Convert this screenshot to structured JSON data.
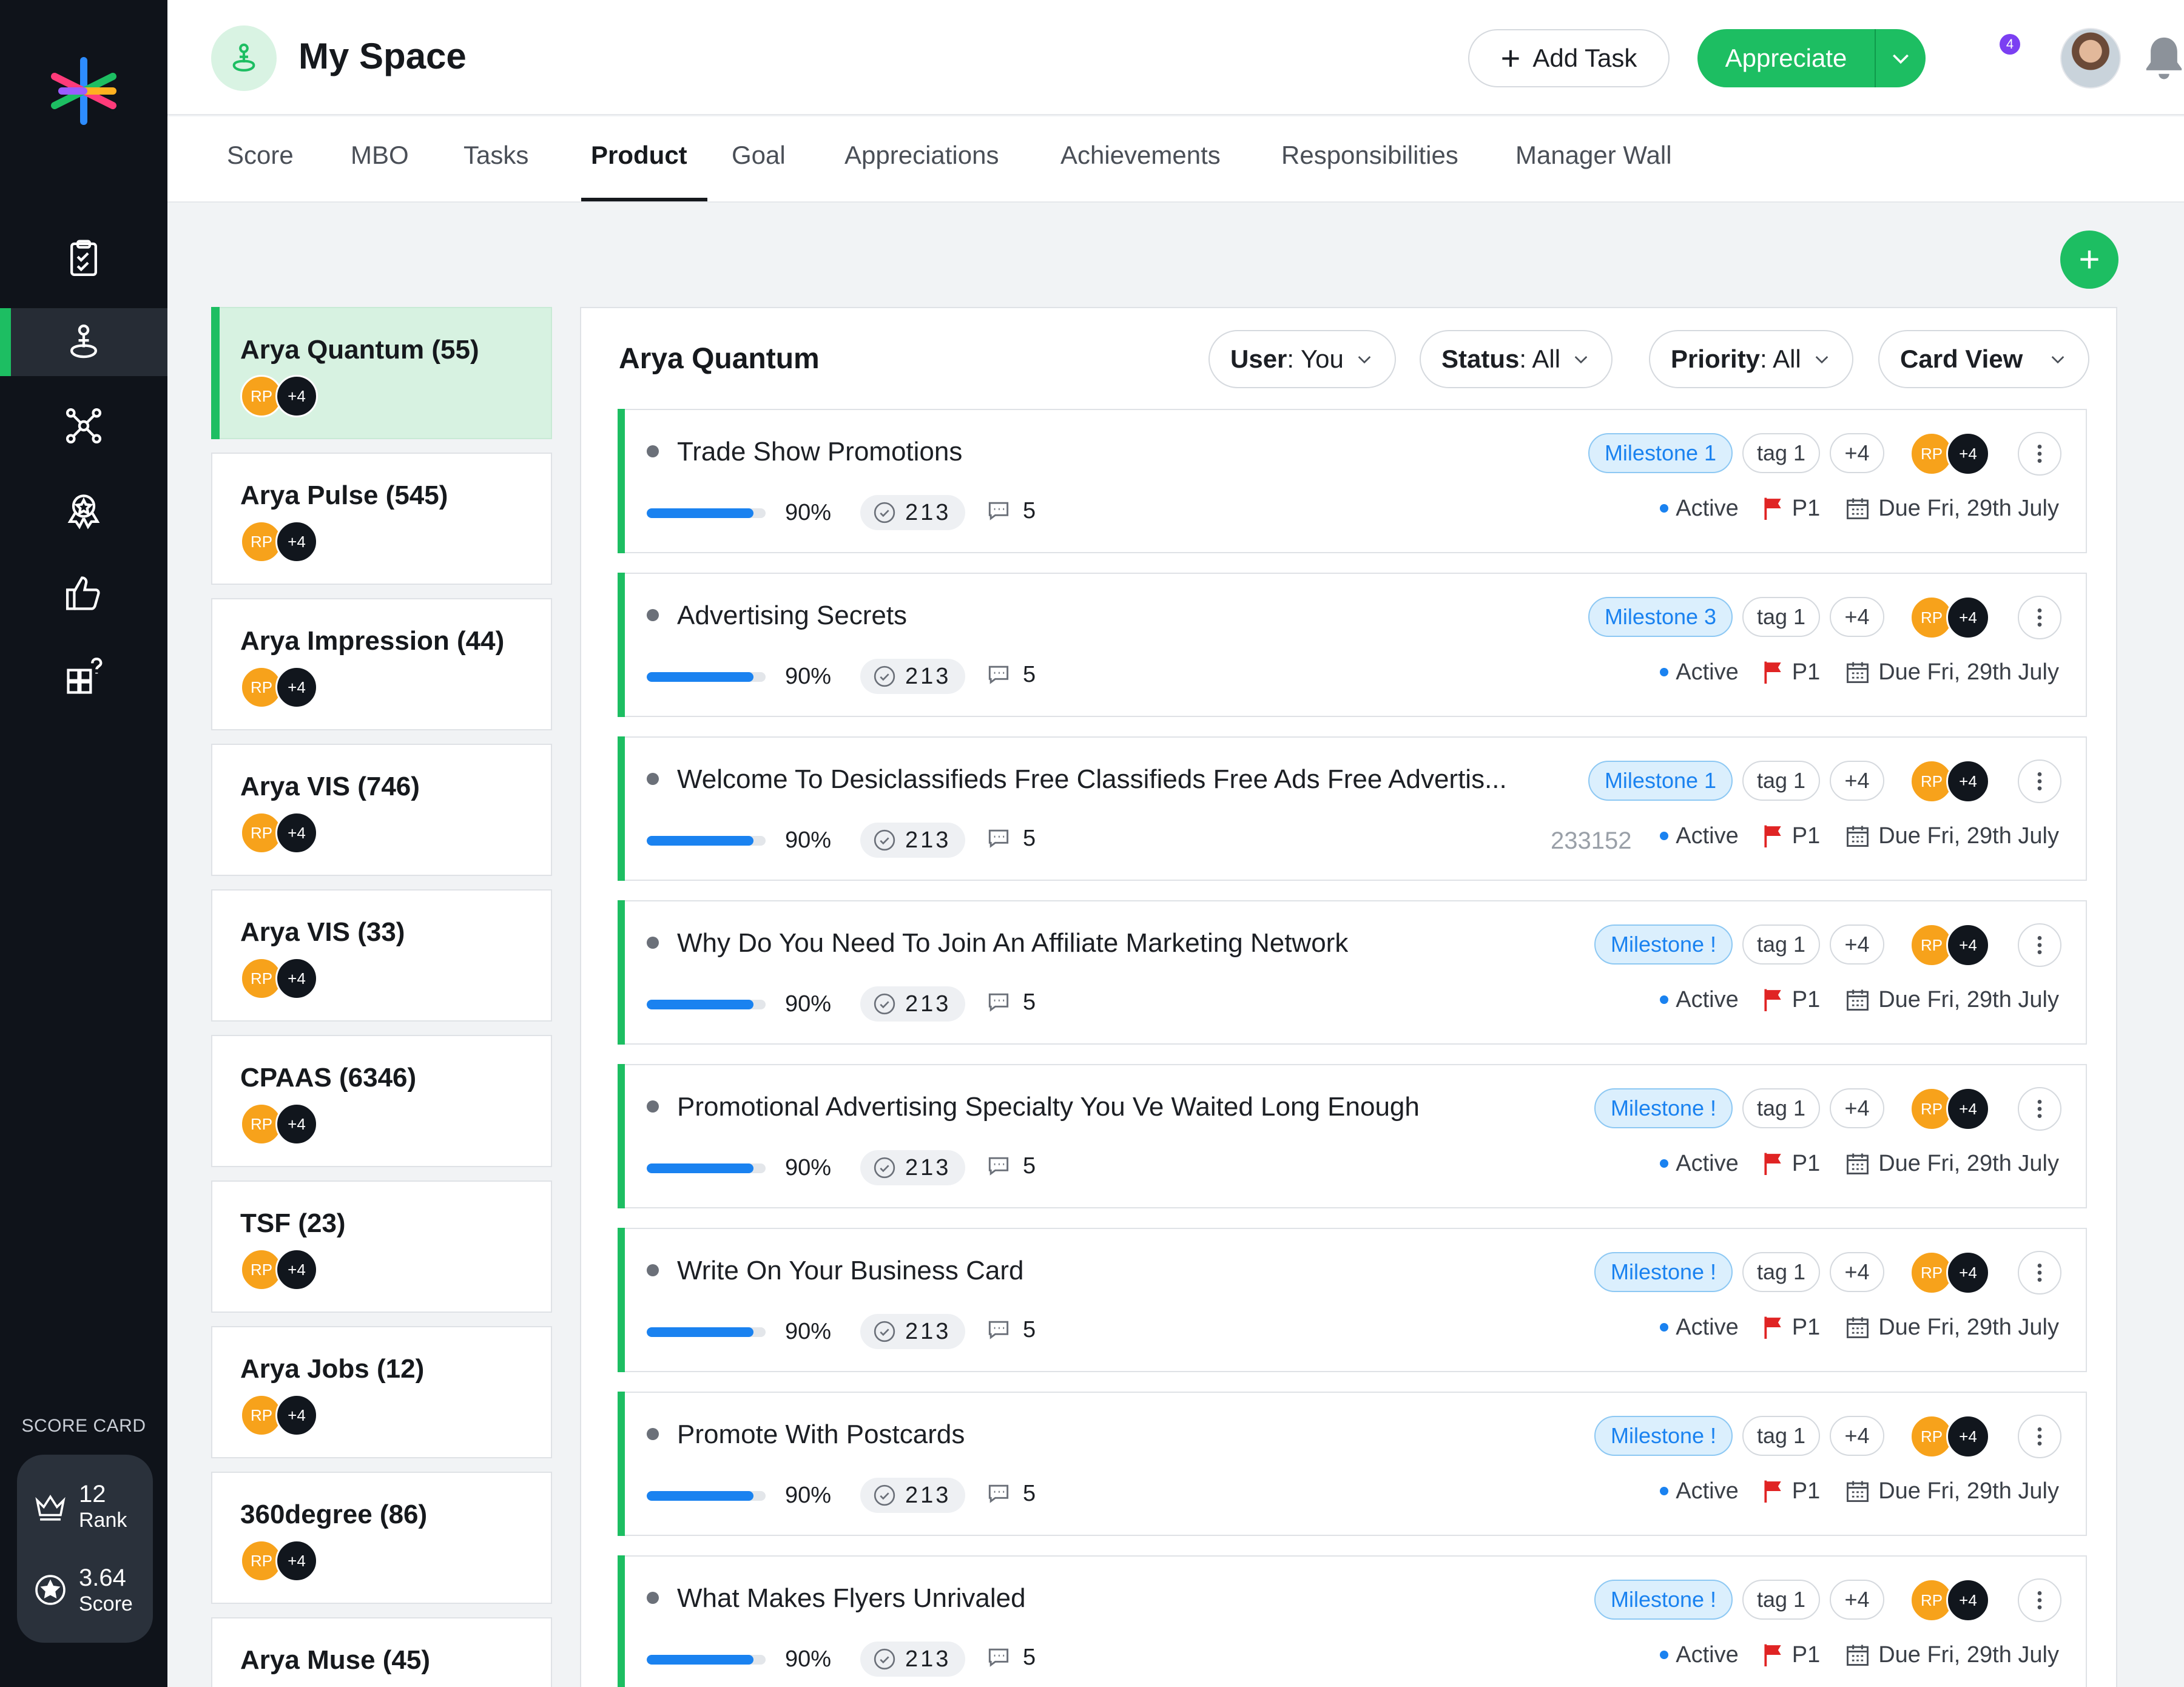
{
  "header": {
    "title": "My Space",
    "add_task_label": "Add Task",
    "appreciate_label": "Appreciate",
    "notification_count": "4"
  },
  "tabs": [
    {
      "label": "Score"
    },
    {
      "label": "MBO"
    },
    {
      "label": "Tasks"
    },
    {
      "label": "Product",
      "active": true
    },
    {
      "label": "Goal"
    },
    {
      "label": "Appreciations"
    },
    {
      "label": "Achievements"
    },
    {
      "label": "Responsibilities"
    },
    {
      "label": "Manager Wall"
    }
  ],
  "scorecard": {
    "caption": "SCORE CARD",
    "rank_value": "12",
    "rank_label": "Rank",
    "score_value": "3.64",
    "score_label": "Score"
  },
  "products": [
    {
      "name": "Arya Quantum (55)",
      "active": true
    },
    {
      "name": "Arya Pulse (545)"
    },
    {
      "name": "Arya Impression (44)"
    },
    {
      "name": "Arya VIS (746)"
    },
    {
      "name": "Arya VIS (33)"
    },
    {
      "name": "CPAAS (6346)"
    },
    {
      "name": "TSF (23)"
    },
    {
      "name": "Arya Jobs (12)"
    },
    {
      "name": "360degree (86)"
    },
    {
      "name": "Arya Muse (45)"
    }
  ],
  "avatar_initials": "RP",
  "avatar_more": "+4",
  "panel": {
    "title": "Arya Quantum",
    "filters": {
      "user_key": "User",
      "user_value": ": You",
      "status_key": "Status",
      "status_value": ": All",
      "priority_key": "Priority",
      "priority_value": ": All",
      "view_label": "Card View"
    }
  },
  "colors": {
    "accent": "#1dbe62",
    "rail": "#0f131a",
    "progress": "#1a82f0",
    "priority_flag": "#e02424",
    "milestone": "#1a82f0",
    "avatar": "#f7a21b"
  },
  "tasks": [
    {
      "title": "Trade Show Promotions",
      "milestone": "Milestone 1",
      "tag": "tag 1",
      "tag_more": "+4",
      "progress_label": "90%",
      "progress": 0.9,
      "count": "213",
      "comments": "5",
      "status": "Active",
      "priority": "P1",
      "due": "Due Fri, 29th July"
    },
    {
      "title": "Advertising Secrets",
      "milestone": "Milestone 3",
      "tag": "tag 1",
      "tag_more": "+4",
      "progress_label": "90%",
      "progress": 0.9,
      "count": "213",
      "comments": "5",
      "status": "Active",
      "priority": "P1",
      "due": "Due Fri, 29th July"
    },
    {
      "title": "Welcome To Desiclassifieds Free Classifieds Free Ads Free Advertis...",
      "milestone": "Milestone 1",
      "tag": "tag 1",
      "tag_more": "+4",
      "progress_label": "90%",
      "progress": 0.9,
      "count": "213",
      "comments": "5",
      "id": "233152",
      "status": "Active",
      "priority": "P1",
      "due": "Due Fri, 29th July"
    },
    {
      "title": "Why Do You Need To Join An Affiliate Marketing Network",
      "milestone": "Milestone !",
      "tag": "tag 1",
      "tag_more": "+4",
      "progress_label": "90%",
      "progress": 0.9,
      "count": "213",
      "comments": "5",
      "status": "Active",
      "priority": "P1",
      "due": "Due Fri, 29th July"
    },
    {
      "title": "Promotional Advertising Specialty You Ve Waited Long Enough",
      "milestone": "Milestone !",
      "tag": "tag 1",
      "tag_more": "+4",
      "progress_label": "90%",
      "progress": 0.9,
      "count": "213",
      "comments": "5",
      "status": "Active",
      "priority": "P1",
      "due": "Due Fri, 29th July"
    },
    {
      "title": "Write On Your Business Card",
      "milestone": "Milestone !",
      "tag": "tag 1",
      "tag_more": "+4",
      "progress_label": "90%",
      "progress": 0.9,
      "count": "213",
      "comments": "5",
      "status": "Active",
      "priority": "P1",
      "due": "Due Fri, 29th July"
    },
    {
      "title": "Promote With Postcards",
      "milestone": "Milestone !",
      "tag": "tag 1",
      "tag_more": "+4",
      "progress_label": "90%",
      "progress": 0.9,
      "count": "213",
      "comments": "5",
      "status": "Active",
      "priority": "P1",
      "due": "Due Fri, 29th July"
    },
    {
      "title": "What Makes Flyers Unrivaled",
      "milestone": "Milestone !",
      "tag": "tag 1",
      "tag_more": "+4",
      "progress_label": "90%",
      "progress": 0.9,
      "count": "213",
      "comments": "5",
      "status": "Active",
      "priority": "P1",
      "due": "Due Fri, 29th July"
    }
  ]
}
